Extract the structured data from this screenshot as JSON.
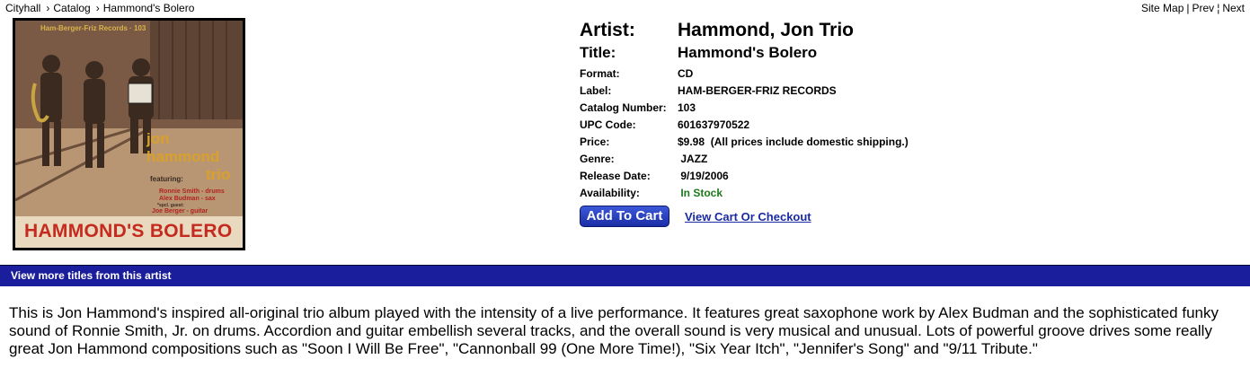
{
  "breadcrumb": {
    "items": [
      "Cityhall",
      "Catalog",
      "Hammond's Bolero"
    ]
  },
  "topright": {
    "site_map": "Site Map",
    "prev": "Prev",
    "next": "Next"
  },
  "cover": {
    "banner_text": "Ham-Berger-Friz Records · 103",
    "line1": "jon",
    "line2": "hammond",
    "line3": "trio",
    "featuring": "featuring:",
    "credit1": "Ronnie Smith - drums",
    "credit2": "Alex Budman - sax",
    "special": "*spcl. guest:",
    "credit3": "Joe Berger - guitar",
    "album_title": "HAMMOND'S BOLERO"
  },
  "product": {
    "artist_label": "Artist:",
    "artist": "Hammond, Jon Trio",
    "title_label": "Title:",
    "title": "Hammond's Bolero",
    "format_label": "Format:",
    "format": "CD",
    "label_label": "Label:",
    "label": "HAM-BERGER-FRIZ RECORDS",
    "catalog_label": "Catalog Number:",
    "catalog": "103",
    "upc_label": "UPC Code:",
    "upc": "601637970522",
    "price_label": "Price:",
    "price": "$9.98  (All prices include domestic shipping.)",
    "genre_label": "Genre:",
    "genre": " JAZZ",
    "release_label": "Release Date:",
    "release": " 9/19/2006",
    "availability_label": "Availability:",
    "availability": " In Stock",
    "availability_color": "#1c7a1c"
  },
  "cart": {
    "add_label": "Add To Cart",
    "view_label": "View Cart Or Checkout"
  },
  "more_titles": "View more titles from this artist",
  "description": "This is Jon Hammond's inspired all-original trio album played with the intensity of a live performance. It features great saxophone work by Alex Budman and the sophisticated funky sound of Ronnie Smith, Jr. on drums. Accordion and guitar embellish several tracks, and the overall sound is very musical and unusual. Lots of powerful groove drives some really great Jon Hammond compositions such as \"Soon I Will Be Free\", \"Cannonball 99 (One More Time!), \"Six Year Itch\", \"Jennifer's Song\" and \"9/11 Tribute.\""
}
